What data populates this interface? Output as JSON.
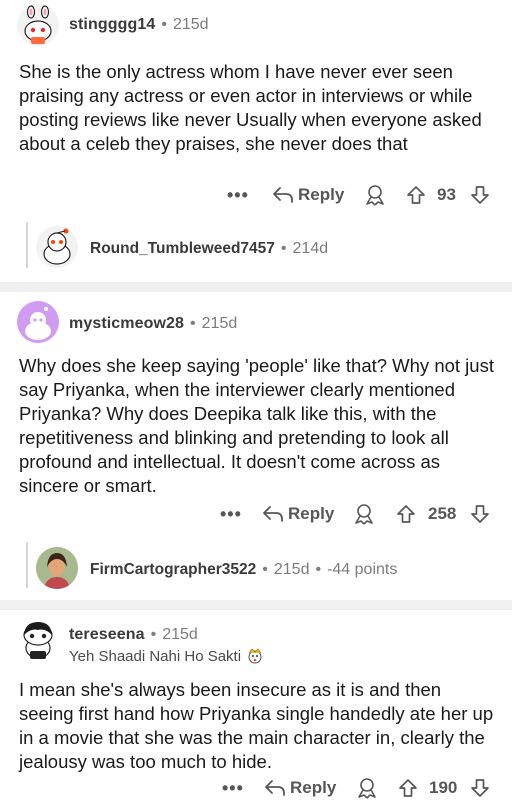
{
  "comments": [
    {
      "username": "stingggg14",
      "age": "215d",
      "text": "She is the only actress whom I have never ever seen praising any actress or even actor in interviews or while posting reviews like never Usually when everyone asked about a celeb they praises, she never does that",
      "more": "•••",
      "reply_label": "Reply",
      "score": "93",
      "reply": {
        "username": "Round_Tumbleweed7457",
        "age": "214d"
      }
    },
    {
      "username": "mysticmeow28",
      "age": "215d",
      "text": "Why does she keep saying 'people' like that? Why not just say Priyanka, when the interviewer clearly mentioned Priyanka? Why does Deepika talk like this, with the repetitiveness and blinking and pretending to look all profound and intellectual. It doesn't come across as sincere or smart.",
      "more": "•••",
      "reply_label": "Reply",
      "score": "258",
      "reply": {
        "username": "FirmCartographer3522",
        "age": "215d",
        "points": "-44 points"
      }
    },
    {
      "username": "tereseena",
      "age": "215d",
      "flair": "Yeh Shaadi Nahi Ho Sakti",
      "text": "I mean she's always been insecure as it is and then seeing first hand how Priyanka single handedly ate her up in a movie that she was the main character in, clearly the jealousy was too much to hide.",
      "more": "•••",
      "reply_label": "Reply",
      "score": "190"
    }
  ],
  "colors": {
    "divider": "#f0f0f0",
    "muted": "#7c7c7c",
    "avatar_purple": "#cf9cf2",
    "snoo_red": "#ff4500"
  },
  "icons": [
    "snoo-avatar-icon",
    "reply-arrow-icon",
    "award-icon",
    "upvote-icon",
    "downvote-icon",
    "more-options-icon"
  ]
}
